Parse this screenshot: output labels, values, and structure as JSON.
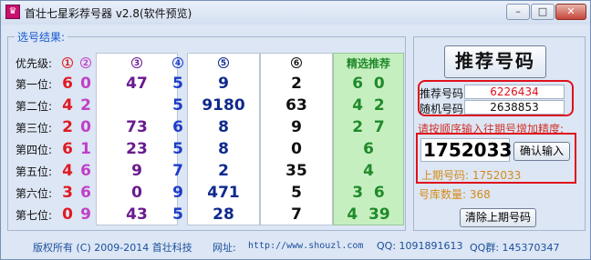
{
  "window": {
    "title": "首壮七星彩荐号器 v2.8(软件预览)",
    "icon": "app-logo-icon",
    "controls": [
      "minimize-icon",
      "maximize-icon",
      "close-icon"
    ]
  },
  "group_label": "选号结果:",
  "headers": {
    "level_label": "优先级:",
    "col1": "1",
    "col2": "2",
    "col3": "3",
    "col4": "4",
    "col5": "5",
    "col6": "6",
    "featured": "精选推荐"
  },
  "rows": [
    {
      "label": "第一位:",
      "c1": "6",
      "c2": "0",
      "c3": "47",
      "c4": "5",
      "c5": "9",
      "c6": "2",
      "pick": "6  0"
    },
    {
      "label": "第二位:",
      "c1": "4",
      "c2": "2",
      "c3": "",
      "c4": "5",
      "c5": "9180",
      "c6": "63",
      "pick": "4  2"
    },
    {
      "label": "第三位:",
      "c1": "2",
      "c2": "0",
      "c3": "73",
      "c4": "6",
      "c5": "8",
      "c6": "9",
      "pick": "2  7"
    },
    {
      "label": "第四位:",
      "c1": "6",
      "c2": "1",
      "c3": "23",
      "c4": "5",
      "c5": "8",
      "c6": "0",
      "pick": "6"
    },
    {
      "label": "第五位:",
      "c1": "4",
      "c2": "6",
      "c3": "9",
      "c4": "7",
      "c5": "2",
      "c6": "35",
      "pick": "4"
    },
    {
      "label": "第六位:",
      "c1": "3",
      "c2": "6",
      "c3": "0",
      "c4": "9",
      "c5": "471",
      "c6": "5",
      "pick": "3  6"
    },
    {
      "label": "第七位:",
      "c1": "0",
      "c2": "9",
      "c3": "43",
      "c4": "5",
      "c5": "28",
      "c6": "7",
      "pick": "4  39"
    }
  ],
  "right": {
    "recommend_button": "推荐号码",
    "rec_label": "推荐号码:",
    "rec_value": "6226434",
    "rand_label": "随机号码:",
    "rand_value": "2638853",
    "hint": "请按顺序输入往期号增加精度:",
    "input_value": "1752033",
    "confirm_button": "确认输入",
    "last_issue": "上期号码: 1752033",
    "pool": "号库数量: 368",
    "clear_button": "清除上期号码"
  },
  "footer": {
    "copyright": "版权所有 (C) 2009-2014 首壮科技",
    "site_label": "网址:",
    "site": "http://www.shouzl.com",
    "qq": "QQ: 1091891613",
    "qq_group": "QQ群: 145370347"
  },
  "colors": {
    "col1": "#e01a22",
    "col2": "#c040c8",
    "col3": "#6a1a8e",
    "col4": "#1d3cc9",
    "col5": "#0f2a8c",
    "col6": "#111111",
    "featured": "#1f8a2a",
    "accent_red": "#e0101c",
    "orange": "#d68a18"
  }
}
